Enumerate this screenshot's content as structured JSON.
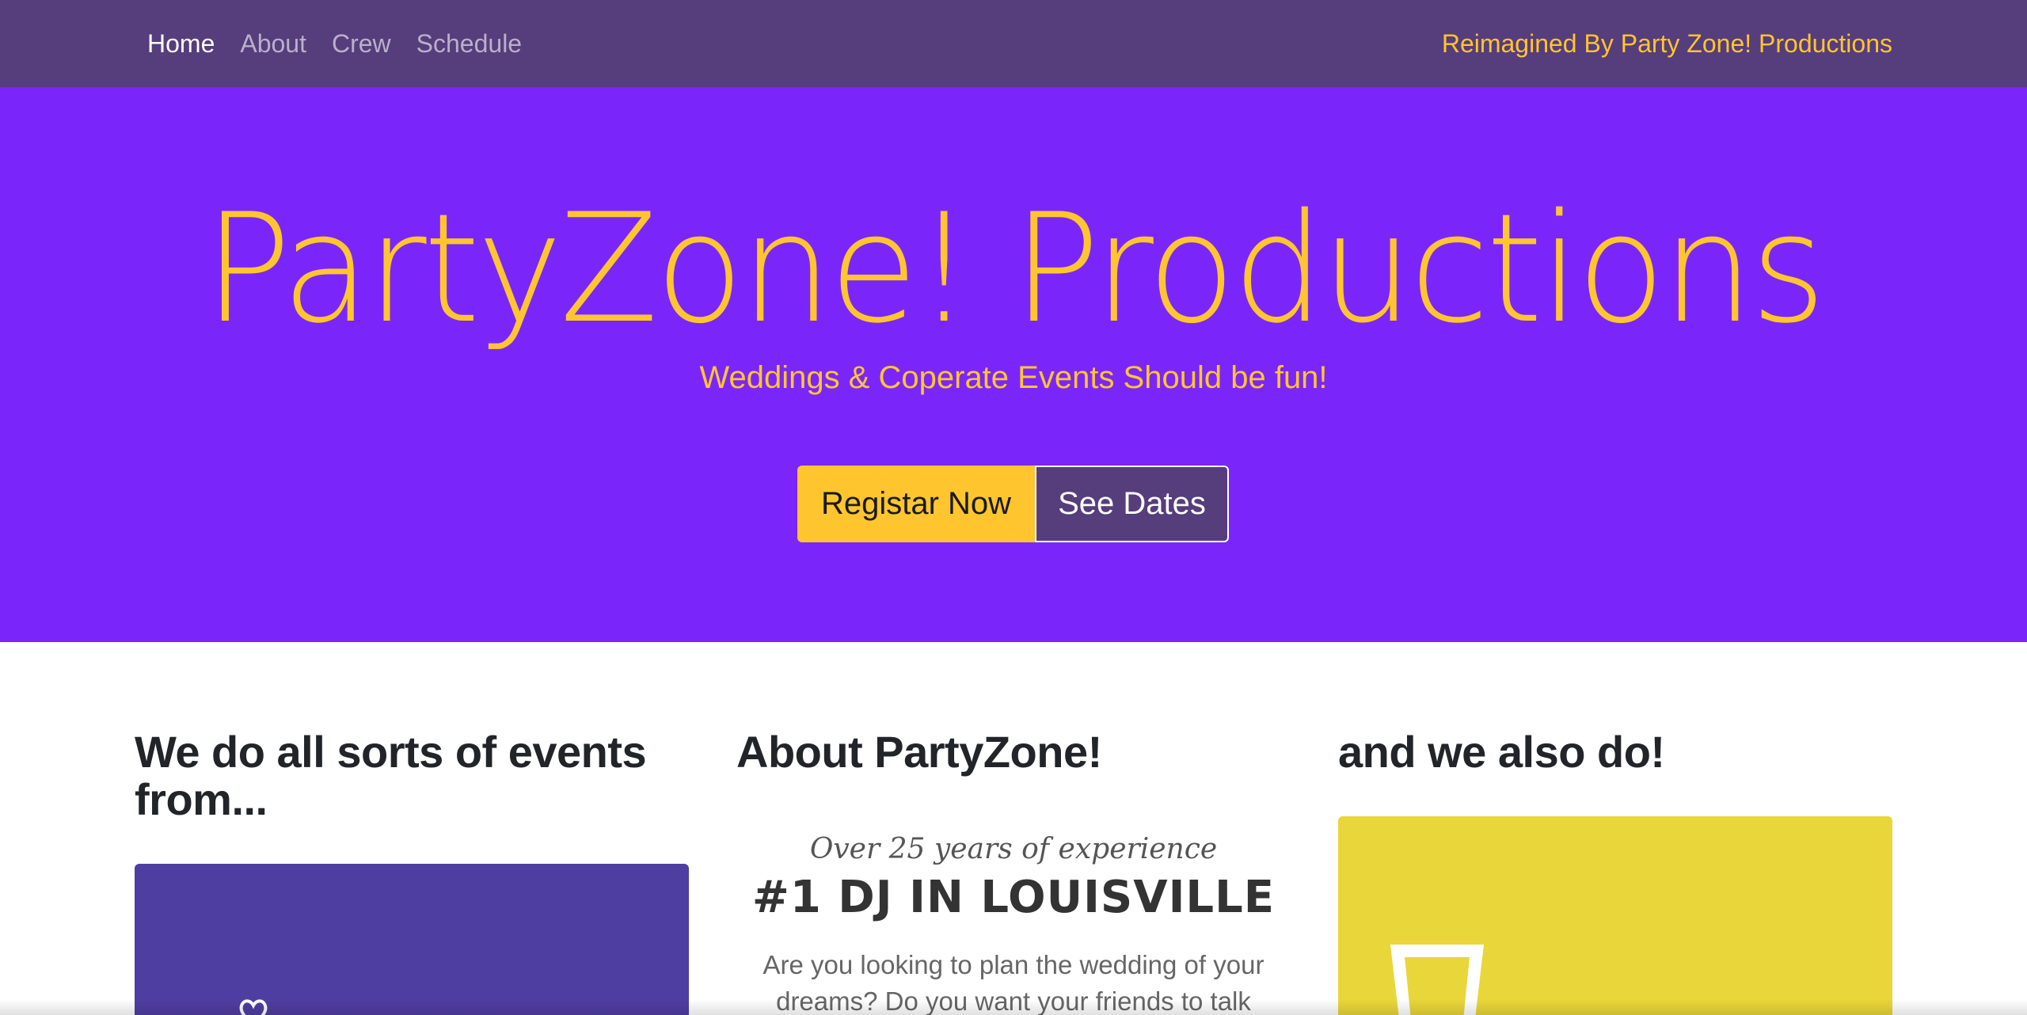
{
  "nav": {
    "links": [
      "Home",
      "About",
      "Crew",
      "Schedule"
    ],
    "brand": "Reimagined By Party Zone! Productions"
  },
  "hero": {
    "title": "PartyZone! Productions",
    "subtitle": "Weddings & Coperate Events Should be fun!",
    "primary_button": "Registar Now",
    "secondary_button": "See Dates"
  },
  "columns": {
    "events_heading": "We do all sorts of events from...",
    "about_heading": "About PartyZone!",
    "also_heading": "and we also do!"
  },
  "about": {
    "kicker": "Over 25 years of experience",
    "headline": "#1 DJ IN LOUISVILLE",
    "body": "Are you looking to plan the wedding of your dreams? Do you want your friends to talk"
  },
  "icons": {
    "events_card": "heart-icon",
    "also_card": "glass-icon"
  },
  "colors": {
    "navbar": "#563d7c",
    "hero": "#7a26fb",
    "accent": "#ffc52f",
    "events_card": "#4f3ea1",
    "also_card": "#e9d63a"
  }
}
